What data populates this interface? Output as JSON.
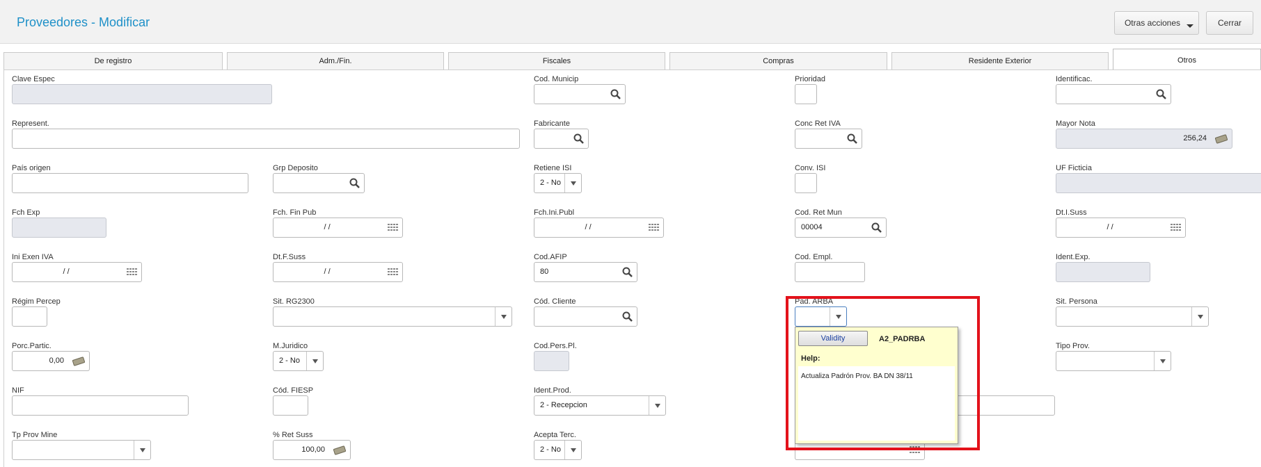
{
  "header": {
    "title": "Proveedores - Modificar",
    "other_actions": "Otras acciones",
    "close": "Cerrar"
  },
  "tabs": [
    "De registro",
    "Adm./Fin.",
    "Fiscales",
    "Compras",
    "Residente Exterior",
    "Otros"
  ],
  "fields": {
    "clave_espec": {
      "label": "Clave Espec",
      "value": ""
    },
    "cod_municip": {
      "label": "Cod. Municip",
      "value": ""
    },
    "prioridad": {
      "label": "Prioridad",
      "value": ""
    },
    "identificac": {
      "label": "Identificac.",
      "value": ""
    },
    "represent": {
      "label": "Represent.",
      "value": ""
    },
    "fabricante": {
      "label": "Fabricante",
      "value": ""
    },
    "conc_ret_iva": {
      "label": "Conc Ret IVA",
      "value": ""
    },
    "mayor_nota": {
      "label": "Mayor Nota",
      "value": "256,24"
    },
    "pais_origen": {
      "label": "País origen",
      "value": ""
    },
    "grp_deposito": {
      "label": "Grp Deposito",
      "value": ""
    },
    "retiene_isi": {
      "label": "Retiene ISI",
      "value": "2 - No"
    },
    "conv_isi": {
      "label": "Conv. ISI",
      "value": ""
    },
    "uf_ficticia": {
      "label": "UF Ficticia",
      "value": ""
    },
    "fch_exp": {
      "label": "Fch Exp",
      "value": ""
    },
    "fch_fin_pub": {
      "label": "Fch. Fin Pub",
      "value": "/ /"
    },
    "fch_ini_publ": {
      "label": "Fch.Ini.Publ",
      "value": "/ /"
    },
    "cod_ret_mun": {
      "label": "Cod. Ret Mun",
      "value": "00004"
    },
    "dt_i_suss": {
      "label": "Dt.I.Suss",
      "value": "/ /"
    },
    "ini_exen_iva": {
      "label": "Ini Exen IVA",
      "value": "/ /"
    },
    "dt_f_suss": {
      "label": "Dt.F.Suss",
      "value": "/ /"
    },
    "cod_afip": {
      "label": "Cod.AFIP",
      "value": "80"
    },
    "cod_empl": {
      "label": "Cod. Empl.",
      "value": ""
    },
    "ident_exp": {
      "label": "Ident.Exp.",
      "value": ""
    },
    "regim_percep": {
      "label": "Régim Percep",
      "value": ""
    },
    "sit_rg2300": {
      "label": "Sit. RG2300",
      "value": ""
    },
    "cod_cliente": {
      "label": "Cód. Cliente",
      "value": ""
    },
    "pad_arba": {
      "label": "Pad. ARBA",
      "value": ""
    },
    "sit_persona": {
      "label": "Sit. Persona",
      "value": ""
    },
    "porc_partic": {
      "label": "Porc.Partic.",
      "value": "0,00"
    },
    "m_juridico": {
      "label": "M.Juridico",
      "value": "2 - No"
    },
    "cod_pers_pl": {
      "label": "Cod.Pers.Pl.",
      "value": ""
    },
    "tipo_prov": {
      "label": "Tipo Prov.",
      "value": ""
    },
    "nif": {
      "label": "NIF",
      "value": ""
    },
    "cod_fiesp": {
      "label": "Cód. FIESP",
      "value": ""
    },
    "ident_prod": {
      "label": "Ident.Prod.",
      "value": "2 - Recepcion"
    },
    "tp_prov_mine": {
      "label": "Tp Prov Mine",
      "value": ""
    },
    "ret_suss": {
      "label": "% Ret Suss",
      "value": "100,00"
    },
    "acepta_terc": {
      "label": "Acepta Terc.",
      "value": "2 - No"
    }
  },
  "popup": {
    "validity": "Validity",
    "param": "A2_PADRBA",
    "help_label": "Help:",
    "help_text": "Actualiza Padrón Prov. BA DN 38/11"
  },
  "colors": {
    "title": "#1e90c8",
    "highlight": "#e3121b",
    "popup_bg": "#ffffcf"
  }
}
